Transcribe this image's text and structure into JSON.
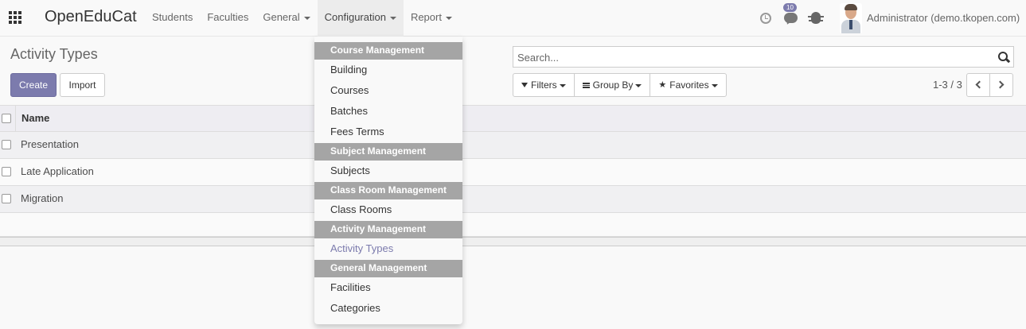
{
  "navbar": {
    "brand": "OpenEduCat",
    "menu": [
      {
        "label": "Students",
        "dropdown": false
      },
      {
        "label": "Faculties",
        "dropdown": false
      },
      {
        "label": "General",
        "dropdown": true
      },
      {
        "label": "Configuration",
        "dropdown": true
      },
      {
        "label": "Report",
        "dropdown": true
      }
    ],
    "messages_badge": "10",
    "user": "Administrator (demo.tkopen.com)"
  },
  "control_panel": {
    "title": "Activity Types",
    "create_label": "Create",
    "import_label": "Import",
    "search_placeholder": "Search...",
    "filters_label": "Filters",
    "group_by_label": "Group By",
    "favorites_label": "Favorites",
    "pager": "1-3 / 3"
  },
  "list": {
    "column_name": "Name",
    "rows": [
      "Presentation",
      "Late Application",
      "Migration"
    ]
  },
  "configuration_menu": {
    "sections": [
      {
        "header": "Course Management",
        "items": [
          "Building",
          "Courses",
          "Batches",
          "Fees Terms"
        ]
      },
      {
        "header": "Subject Management",
        "items": [
          "Subjects"
        ]
      },
      {
        "header": "Class Room Management",
        "items": [
          "Class Rooms"
        ]
      },
      {
        "header": "Activity Management",
        "items": [
          "Activity Types"
        ]
      },
      {
        "header": "General Management",
        "items": [
          "Facilities",
          "Categories"
        ]
      }
    ],
    "active_item": "Activity Types"
  },
  "colors": {
    "accent": "#7c7bad",
    "dropdown_header_bg": "#a5a5a5"
  },
  "icons": [
    "apps-grid-icon",
    "clock-icon",
    "chat-icon",
    "bug-icon",
    "search-icon",
    "funnel-icon",
    "list-icon",
    "star-icon",
    "chevron-left-icon",
    "chevron-right-icon"
  ]
}
